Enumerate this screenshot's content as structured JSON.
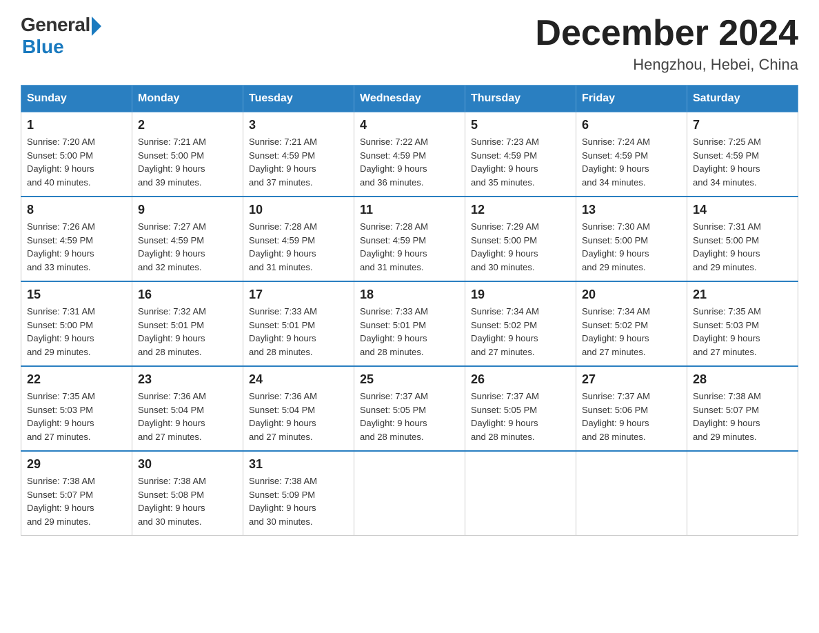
{
  "logo": {
    "general": "General",
    "blue": "Blue"
  },
  "title": "December 2024",
  "subtitle": "Hengzhou, Hebei, China",
  "headers": [
    "Sunday",
    "Monday",
    "Tuesday",
    "Wednesday",
    "Thursday",
    "Friday",
    "Saturday"
  ],
  "weeks": [
    [
      {
        "day": "1",
        "sunrise": "7:20 AM",
        "sunset": "5:00 PM",
        "daylight": "9 hours and 40 minutes."
      },
      {
        "day": "2",
        "sunrise": "7:21 AM",
        "sunset": "5:00 PM",
        "daylight": "9 hours and 39 minutes."
      },
      {
        "day": "3",
        "sunrise": "7:21 AM",
        "sunset": "4:59 PM",
        "daylight": "9 hours and 37 minutes."
      },
      {
        "day": "4",
        "sunrise": "7:22 AM",
        "sunset": "4:59 PM",
        "daylight": "9 hours and 36 minutes."
      },
      {
        "day": "5",
        "sunrise": "7:23 AM",
        "sunset": "4:59 PM",
        "daylight": "9 hours and 35 minutes."
      },
      {
        "day": "6",
        "sunrise": "7:24 AM",
        "sunset": "4:59 PM",
        "daylight": "9 hours and 34 minutes."
      },
      {
        "day": "7",
        "sunrise": "7:25 AM",
        "sunset": "4:59 PM",
        "daylight": "9 hours and 34 minutes."
      }
    ],
    [
      {
        "day": "8",
        "sunrise": "7:26 AM",
        "sunset": "4:59 PM",
        "daylight": "9 hours and 33 minutes."
      },
      {
        "day": "9",
        "sunrise": "7:27 AM",
        "sunset": "4:59 PM",
        "daylight": "9 hours and 32 minutes."
      },
      {
        "day": "10",
        "sunrise": "7:28 AM",
        "sunset": "4:59 PM",
        "daylight": "9 hours and 31 minutes."
      },
      {
        "day": "11",
        "sunrise": "7:28 AM",
        "sunset": "4:59 PM",
        "daylight": "9 hours and 31 minutes."
      },
      {
        "day": "12",
        "sunrise": "7:29 AM",
        "sunset": "5:00 PM",
        "daylight": "9 hours and 30 minutes."
      },
      {
        "day": "13",
        "sunrise": "7:30 AM",
        "sunset": "5:00 PM",
        "daylight": "9 hours and 29 minutes."
      },
      {
        "day": "14",
        "sunrise": "7:31 AM",
        "sunset": "5:00 PM",
        "daylight": "9 hours and 29 minutes."
      }
    ],
    [
      {
        "day": "15",
        "sunrise": "7:31 AM",
        "sunset": "5:00 PM",
        "daylight": "9 hours and 29 minutes."
      },
      {
        "day": "16",
        "sunrise": "7:32 AM",
        "sunset": "5:01 PM",
        "daylight": "9 hours and 28 minutes."
      },
      {
        "day": "17",
        "sunrise": "7:33 AM",
        "sunset": "5:01 PM",
        "daylight": "9 hours and 28 minutes."
      },
      {
        "day": "18",
        "sunrise": "7:33 AM",
        "sunset": "5:01 PM",
        "daylight": "9 hours and 28 minutes."
      },
      {
        "day": "19",
        "sunrise": "7:34 AM",
        "sunset": "5:02 PM",
        "daylight": "9 hours and 27 minutes."
      },
      {
        "day": "20",
        "sunrise": "7:34 AM",
        "sunset": "5:02 PM",
        "daylight": "9 hours and 27 minutes."
      },
      {
        "day": "21",
        "sunrise": "7:35 AM",
        "sunset": "5:03 PM",
        "daylight": "9 hours and 27 minutes."
      }
    ],
    [
      {
        "day": "22",
        "sunrise": "7:35 AM",
        "sunset": "5:03 PM",
        "daylight": "9 hours and 27 minutes."
      },
      {
        "day": "23",
        "sunrise": "7:36 AM",
        "sunset": "5:04 PM",
        "daylight": "9 hours and 27 minutes."
      },
      {
        "day": "24",
        "sunrise": "7:36 AM",
        "sunset": "5:04 PM",
        "daylight": "9 hours and 27 minutes."
      },
      {
        "day": "25",
        "sunrise": "7:37 AM",
        "sunset": "5:05 PM",
        "daylight": "9 hours and 28 minutes."
      },
      {
        "day": "26",
        "sunrise": "7:37 AM",
        "sunset": "5:05 PM",
        "daylight": "9 hours and 28 minutes."
      },
      {
        "day": "27",
        "sunrise": "7:37 AM",
        "sunset": "5:06 PM",
        "daylight": "9 hours and 28 minutes."
      },
      {
        "day": "28",
        "sunrise": "7:38 AM",
        "sunset": "5:07 PM",
        "daylight": "9 hours and 29 minutes."
      }
    ],
    [
      {
        "day": "29",
        "sunrise": "7:38 AM",
        "sunset": "5:07 PM",
        "daylight": "9 hours and 29 minutes."
      },
      {
        "day": "30",
        "sunrise": "7:38 AM",
        "sunset": "5:08 PM",
        "daylight": "9 hours and 30 minutes."
      },
      {
        "day": "31",
        "sunrise": "7:38 AM",
        "sunset": "5:09 PM",
        "daylight": "9 hours and 30 minutes."
      },
      null,
      null,
      null,
      null
    ]
  ],
  "labels": {
    "sunrise": "Sunrise:",
    "sunset": "Sunset:",
    "daylight": "Daylight:"
  }
}
